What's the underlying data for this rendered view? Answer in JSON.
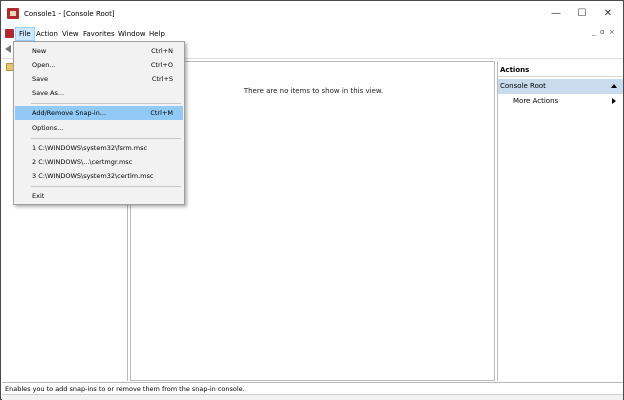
{
  "window": {
    "title": "Console1 - [Console Root]",
    "controls": {
      "minimize": "—",
      "maximize": "☐",
      "close": "✕"
    },
    "mdi_controls": "_  ɑ  ×"
  },
  "menubar": {
    "items": [
      "File",
      "Action",
      "View",
      "Favorites",
      "Window",
      "Help"
    ],
    "active": "File"
  },
  "file_menu": {
    "items": [
      {
        "label": "New",
        "shortcut": "Ctrl+N"
      },
      {
        "label": "Open...",
        "shortcut": "Ctrl+O"
      },
      {
        "label": "Save",
        "shortcut": "Ctrl+S"
      },
      {
        "label": "Save As...",
        "shortcut": ""
      },
      {
        "label": "Add/Remove Snap-in...",
        "shortcut": "Ctrl+M",
        "highlighted": true
      },
      {
        "label": "Options...",
        "shortcut": ""
      },
      {
        "label": "1 C:\\WINDOWS\\system32\\fsrm.msc",
        "shortcut": ""
      },
      {
        "label": "2 C:\\WINDOWS\\...\\certmgr.msc",
        "shortcut": ""
      },
      {
        "label": "3 C:\\WINDOWS\\system32\\certlm.msc",
        "shortcut": ""
      },
      {
        "label": "Exit",
        "shortcut": ""
      }
    ]
  },
  "center_pane": {
    "empty_message": "There are no items to show in this view."
  },
  "actions_pane": {
    "header": "Actions",
    "section": "Console Root",
    "items": [
      {
        "label": "More Actions",
        "has_submenu": true
      }
    ]
  },
  "statusbar": {
    "text": "Enables you to add snap-ins to or remove them from the snap-in console."
  },
  "colors": {
    "menu_highlight": "#91c9f7",
    "active_menu": "#cce8ff",
    "actions_section_bg": "#c9dcee",
    "app_icon": "#b3272d"
  }
}
